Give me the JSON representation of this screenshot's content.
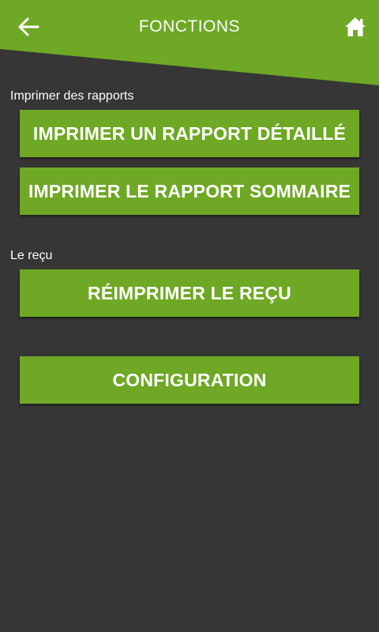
{
  "header": {
    "title": "FONCTIONS",
    "back_icon": "arrow-left-icon",
    "home_icon": "home-icon"
  },
  "sections": {
    "reports_label": "Imprimer des rapports",
    "receipt_label": "Le reçu"
  },
  "buttons": {
    "detailed_report": "IMPRIMER UN RAPPORT DÉTAILLÉ",
    "summary_report": "IMPRIMER LE RAPPORT SOMMAIRE",
    "reprint_receipt": "RÉIMPRIMER LE REÇU",
    "configuration": "CONFIGURATION"
  },
  "colors": {
    "accent": "#6ea824",
    "background": "#363636",
    "text": "#ffffff"
  }
}
